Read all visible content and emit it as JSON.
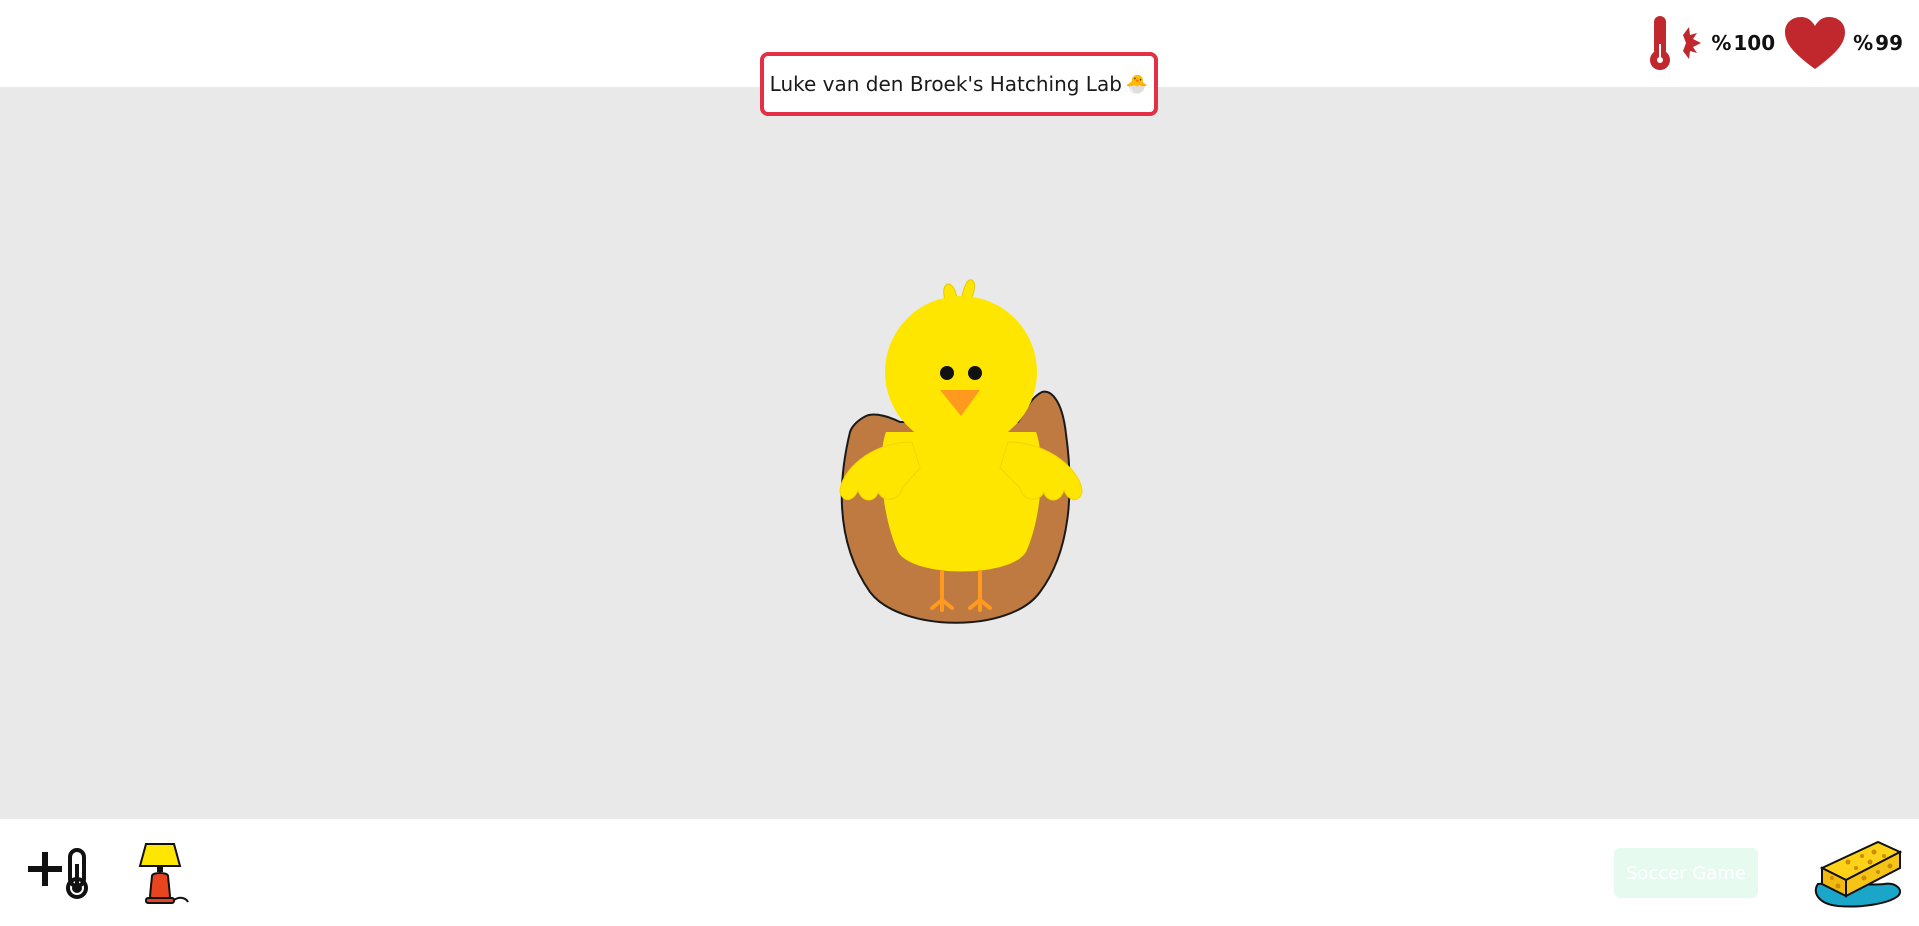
{
  "header": {
    "title": "Luke van den Broek's Hatching Lab",
    "title_emoji": "🐣"
  },
  "stats": {
    "temperature": {
      "icon": "thermometer-icon",
      "percent_sign": "%",
      "value": "100"
    },
    "health": {
      "icon": "heart-icon",
      "percent_sign": "%",
      "value": "99"
    }
  },
  "stage": {
    "character": "hatched-chick-in-eggshell"
  },
  "toolbar": {
    "increase_temp_icon": "plus-thermometer-icon",
    "lamp_icon": "lamp-icon",
    "soccer_button_label": "Soccer Game",
    "sponge_icon": "sponge-icon"
  },
  "colors": {
    "accent_red": "#e33044",
    "stat_red": "#c0282d",
    "chick_yellow": "#ffe600",
    "eggshell_brown": "#bf7a42",
    "beak_orange": "#ff9a1f",
    "stage_bg": "#e9e9e9",
    "soccer_btn_bg": "#e6faf0"
  }
}
